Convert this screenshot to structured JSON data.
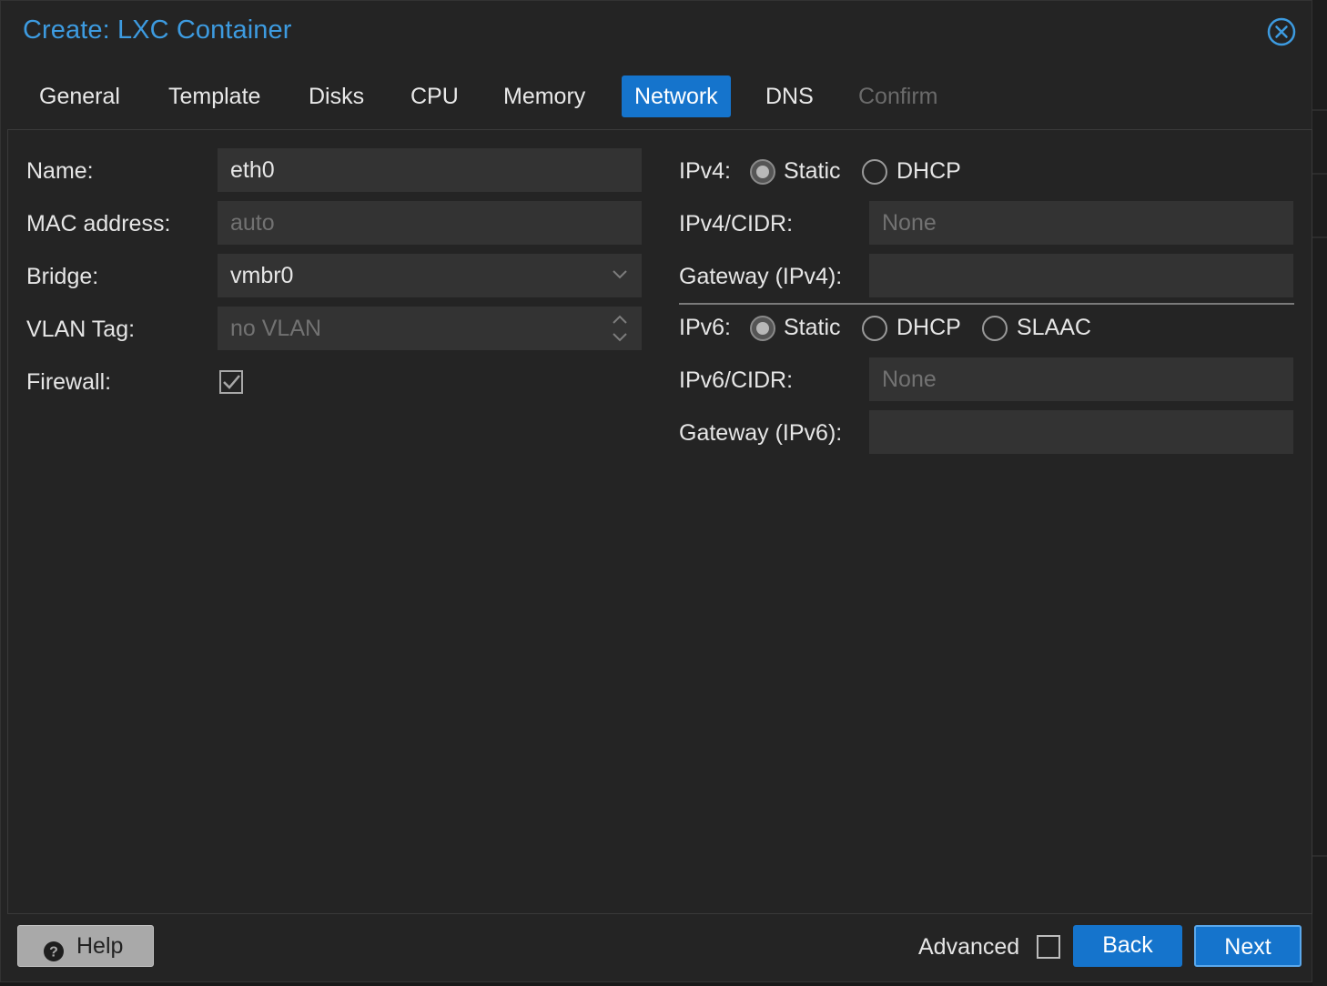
{
  "dialog": {
    "title": "Create: LXC Container",
    "close_icon": "close-circle-icon"
  },
  "tabs": [
    {
      "label": "General",
      "state": "normal"
    },
    {
      "label": "Template",
      "state": "normal"
    },
    {
      "label": "Disks",
      "state": "normal"
    },
    {
      "label": "CPU",
      "state": "normal"
    },
    {
      "label": "Memory",
      "state": "normal"
    },
    {
      "label": "Network",
      "state": "active"
    },
    {
      "label": "DNS",
      "state": "normal"
    },
    {
      "label": "Confirm",
      "state": "disabled"
    }
  ],
  "left": {
    "name_label": "Name:",
    "name_value": "eth0",
    "mac_label": "MAC address:",
    "mac_placeholder": "auto",
    "bridge_label": "Bridge:",
    "bridge_value": "vmbr0",
    "vlan_label": "VLAN Tag:",
    "vlan_placeholder": "no VLAN",
    "firewall_label": "Firewall:",
    "firewall_checked": true
  },
  "right": {
    "ipv4_label": "IPv4:",
    "ipv4_options": [
      "Static",
      "DHCP"
    ],
    "ipv4_selected": "Static",
    "ipv4_cidr_label": "IPv4/CIDR:",
    "ipv4_cidr_placeholder": "None",
    "gateway4_label": "Gateway (IPv4):",
    "gateway4_value": "",
    "ipv6_label": "IPv6:",
    "ipv6_options": [
      "Static",
      "DHCP",
      "SLAAC"
    ],
    "ipv6_selected": "Static",
    "ipv6_cidr_label": "IPv6/CIDR:",
    "ipv6_cidr_placeholder": "None",
    "gateway6_label": "Gateway (IPv6):",
    "gateway6_value": ""
  },
  "footer": {
    "help_label": "Help",
    "help_icon": "question-circle-icon",
    "advanced_label": "Advanced",
    "advanced_checked": false,
    "back_label": "Back",
    "next_label": "Next"
  },
  "colors": {
    "accent": "#1574cc",
    "title": "#3d9be0",
    "background": "#242424"
  }
}
